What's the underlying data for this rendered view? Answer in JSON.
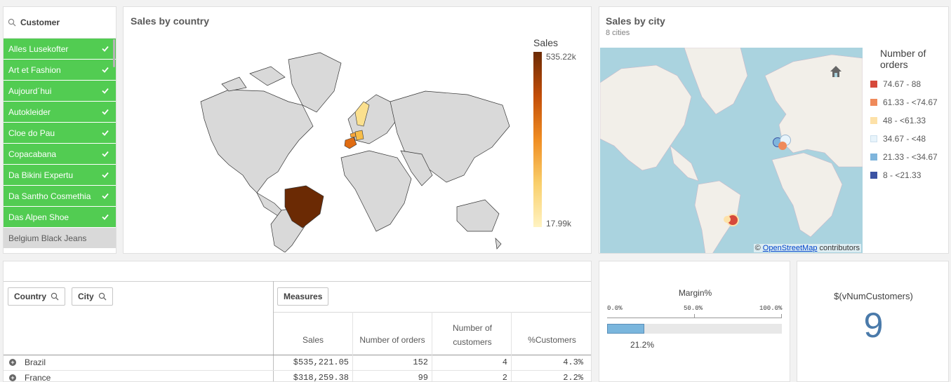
{
  "filter": {
    "title": "Customer",
    "selected": [
      "Alles Lusekofter",
      "Art et Fashion",
      "Aujourd´hui",
      "Autokleider",
      "Cloe do Pau",
      "Copacabana",
      "Da Bikini Expertu",
      "Da Santho Cosmethia",
      "Das Alpen Shoe"
    ],
    "alternative": [
      "Belgium Black Jeans"
    ]
  },
  "country_map": {
    "title": "Sales by country",
    "legend_title": "Sales",
    "legend_max": "535.22k",
    "legend_min": "17.99k",
    "colors": {
      "high": "#6b2a04",
      "mid": "#f08d22",
      "low": "#fff3c2",
      "land": "#d9d9d9"
    }
  },
  "city_map": {
    "title": "Sales by city",
    "subtitle": "8 cities",
    "legend_title_1": "Number of",
    "legend_title_2": "orders",
    "legend": [
      {
        "label": "74.67 - 88",
        "color": "#d6493b"
      },
      {
        "label": "61.33 - <74.67",
        "color": "#ef8a5a"
      },
      {
        "label": "48 - <61.33",
        "color": "#fde1a8"
      },
      {
        "label": "34.67 - <48",
        "color": "#e8f4fb"
      },
      {
        "label": "21.33 - <34.67",
        "color": "#7fb5dc"
      },
      {
        "label": "8 - <21.33",
        "color": "#3b53a3"
      }
    ],
    "attribution_prefix": "©",
    "attribution_link": "OpenStreetMap",
    "attribution_suffix": "contributors"
  },
  "table": {
    "dim_chips": [
      "Country",
      "City"
    ],
    "measures_chip": "Measures",
    "headers": [
      "Sales",
      "Number of orders",
      "Number of customers",
      "%Customers"
    ],
    "rows": [
      {
        "name": "Brazil",
        "sales": "$535,221.05",
        "orders": "152",
        "customers": "4",
        "pct": "4.3%"
      },
      {
        "name": "France",
        "sales": "$318,259.38",
        "orders": "99",
        "customers": "2",
        "pct": "2.2%"
      }
    ]
  },
  "margin_kpi": {
    "title": "Margin%",
    "ticks": [
      "0.0%",
      "50.0%",
      "100.0%"
    ],
    "value": "21.2%",
    "fraction": 0.212,
    "bar_color": "#7ab6dd"
  },
  "num_kpi": {
    "title": "$(vNumCustomers)",
    "value": "9",
    "value_color": "#4a7aaa"
  }
}
